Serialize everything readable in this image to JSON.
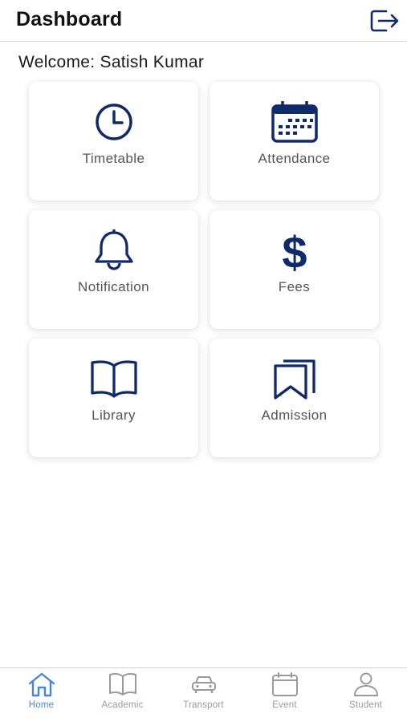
{
  "header": {
    "title": "Dashboard",
    "logout_icon": "logout-icon"
  },
  "welcome": "Welcome: Satish Kumar",
  "colors": {
    "icon_navy": "#0e2a6b",
    "active_tab": "#4a86d8",
    "inactive_tab": "#9a9a9a"
  },
  "cards": [
    {
      "label": "Timetable",
      "icon": "clock-icon"
    },
    {
      "label": "Attendance",
      "icon": "calendar-icon"
    },
    {
      "label": "Notification",
      "icon": "bell-icon"
    },
    {
      "label": "Fees",
      "icon": "dollar-icon"
    },
    {
      "label": "Library",
      "icon": "book-icon"
    },
    {
      "label": "Admission",
      "icon": "bookmarks-icon"
    }
  ],
  "tabs": [
    {
      "label": "Home",
      "icon": "home-icon",
      "active": true
    },
    {
      "label": "Academic",
      "icon": "book-icon",
      "active": false
    },
    {
      "label": "Transport",
      "icon": "car-icon",
      "active": false
    },
    {
      "label": "Event",
      "icon": "calendar-icon",
      "active": false
    },
    {
      "label": "Student",
      "icon": "user-icon",
      "active": false
    }
  ]
}
